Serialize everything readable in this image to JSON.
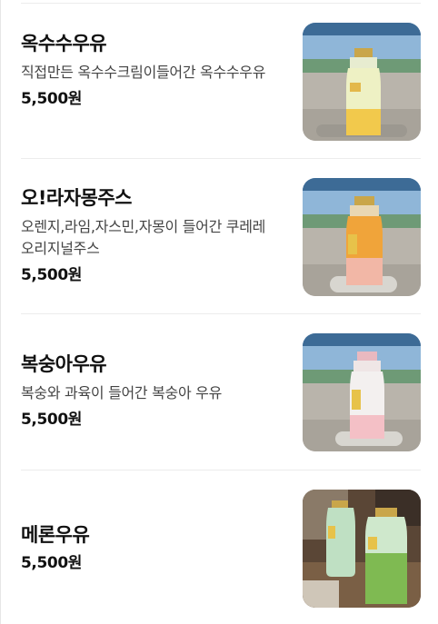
{
  "menu": {
    "items": [
      {
        "name": "옥수수우유",
        "description": "직접만든 옥수수크림이들어간 옥수수우유",
        "price": "5,500원",
        "image": "corn-milk-bottle-photo"
      },
      {
        "name": "오!라자몽주스",
        "description": "오렌지,라임,자스민,자몽이 들어간 쿠레레 오리지널주스",
        "price": "5,500원",
        "image": "grapefruit-juice-bottle-photo"
      },
      {
        "name": "복숭아우유",
        "description": "복숭와 과육이 들어간 복숭아 우유",
        "price": "5,500원",
        "image": "peach-milk-bottle-photo"
      },
      {
        "name": "메론우유",
        "description": "",
        "price": "5,500원",
        "image": "melon-milk-bottles-photo"
      }
    ]
  }
}
